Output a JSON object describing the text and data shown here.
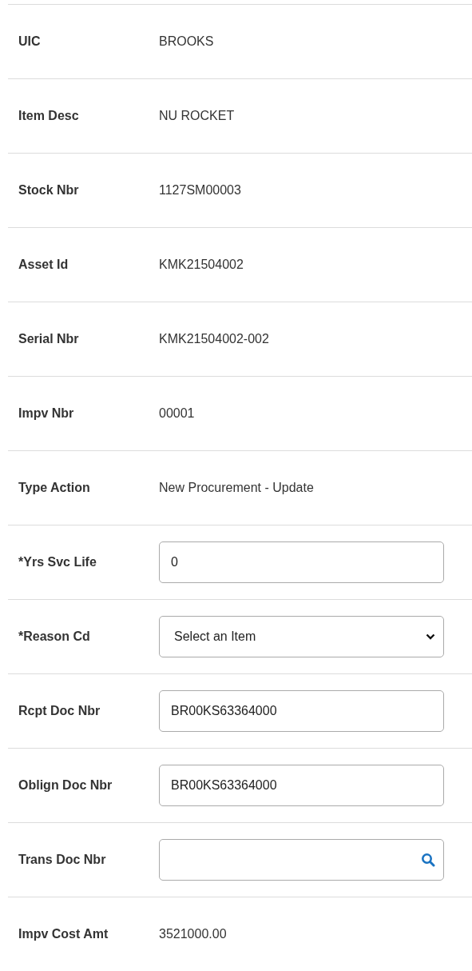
{
  "fields": [
    {
      "kind": "text",
      "label": "UIC",
      "value": "BROOKS"
    },
    {
      "kind": "text",
      "label": "Item Desc",
      "value": "NU ROCKET"
    },
    {
      "kind": "text",
      "label": "Stock Nbr",
      "value": "1127SM00003"
    },
    {
      "kind": "text",
      "label": "Asset Id",
      "value": "KMK21504002"
    },
    {
      "kind": "text",
      "label": "Serial Nbr",
      "value": "KMK21504002-002"
    },
    {
      "kind": "text",
      "label": "Impv Nbr",
      "value": "00001"
    },
    {
      "kind": "text",
      "label": "Type Action",
      "value": "New Procurement - Update"
    },
    {
      "kind": "input",
      "label": "*Yrs Svc Life",
      "value": "0"
    },
    {
      "kind": "select",
      "label": "*Reason Cd",
      "value": "Select an Item"
    },
    {
      "kind": "input",
      "label": "Rcpt Doc Nbr",
      "value": "BR00KS63364000"
    },
    {
      "kind": "input",
      "label": "Oblign Doc Nbr",
      "value": "BR00KS63364000"
    },
    {
      "kind": "lookup",
      "label": "Trans Doc Nbr"
    },
    {
      "kind": "text",
      "label": "Impv Cost Amt",
      "value": "3521000.00"
    }
  ]
}
